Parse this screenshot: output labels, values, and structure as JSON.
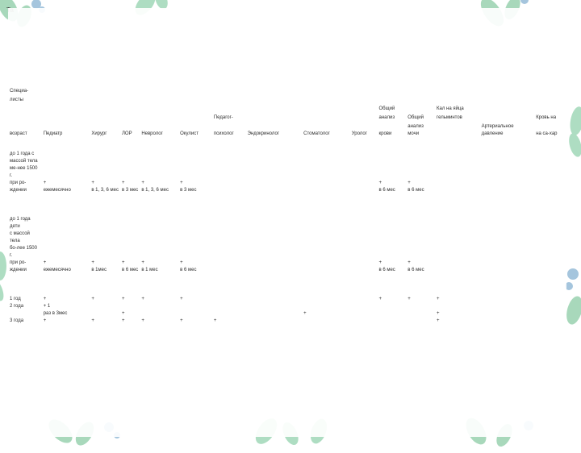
{
  "title_prefix": "Та",
  "section_label": [
    "Специа-",
    "листы"
  ],
  "columns": {
    "c0": "возраст",
    "c1": "Педиатр",
    "c2": "Хирург",
    "c3": "ЛОР",
    "c4": "Невролог",
    "c5": "Окулист",
    "c6": [
      "Педагог-",
      "психолог"
    ],
    "c7": "Эндокринолог",
    "c8": "Стоматолог",
    "c9": "Уролог",
    "c10": [
      "Общий",
      "анализ",
      "крови"
    ],
    "c11": [
      "Общий",
      "анализ мочи"
    ],
    "c12": [
      "Кал на яйца",
      "гельминтов"
    ],
    "c13": "Артериальное давление",
    "c14": [
      "Кровь на",
      "сахар",
      "на са-хар"
    ]
  },
  "rows": [
    {
      "label": [
        "до 1 года с",
        "массой тела",
        "ме-нее 1500 г.",
        "при ро-",
        "ждении"
      ],
      "cells": {
        "c1": [
          "",
          "",
          "",
          "+",
          "ежемесячно"
        ],
        "c2": [
          "",
          "",
          "",
          "+",
          "в 1, 3, 6 мес"
        ],
        "c3": [
          "",
          "",
          "",
          "+",
          "в 3 мес"
        ],
        "c4": [
          "",
          "",
          "",
          "+",
          "в 1, 3, 6 мес"
        ],
        "c5": [
          "",
          "",
          "",
          "+",
          "в 3 мес"
        ],
        "c10": [
          "",
          "",
          "",
          "+",
          "в 6 мес"
        ],
        "c11": [
          "",
          "",
          "",
          "+",
          "в 6 мес"
        ]
      }
    },
    {
      "label": [
        "до 1 года дети",
        "с массой тела",
        "бо-лее 1500 г.",
        "при ро-",
        "ждении"
      ],
      "cells": {
        "c1": [
          "",
          "",
          "",
          "+",
          "ежемесячно"
        ],
        "c2": [
          "",
          "",
          "",
          "+",
          "в 1мес"
        ],
        "c3": [
          "",
          "",
          "",
          "+",
          "в 6 мес"
        ],
        "c4": [
          "",
          "",
          "",
          "+",
          "в 1 мес"
        ],
        "c5": [
          "",
          "",
          "",
          "+",
          "в 6 мес"
        ],
        "c10": [
          "",
          "",
          "",
          "+",
          "в 6 мес"
        ],
        "c11": [
          "",
          "",
          "",
          "+",
          "в 6 мес"
        ]
      }
    },
    {
      "label": [
        "1 год"
      ],
      "cells": {
        "c1": [
          "+"
        ],
        "c2": [
          "+"
        ],
        "c3": [
          "+"
        ],
        "c4": [
          "+"
        ],
        "c5": [
          "+"
        ],
        "c10": [
          "+"
        ],
        "c11": [
          "+"
        ],
        "c12": [
          "+"
        ]
      }
    },
    {
      "label": [
        "2 года"
      ],
      "cells": {
        "c1": [
          "+ 1",
          "раз в 3мес"
        ],
        "c3": [
          "",
          "+"
        ],
        "c8": [
          "",
          "+"
        ],
        "c12": [
          "",
          "+"
        ]
      }
    },
    {
      "label": [
        "3 года"
      ],
      "cells": {
        "c1": [
          "+"
        ],
        "c2": [
          "+"
        ],
        "c3": [
          "+"
        ],
        "c4": [
          "+"
        ],
        "c5": [
          "+"
        ],
        "c6": [
          "+"
        ],
        "c12": [
          "+"
        ]
      }
    }
  ]
}
